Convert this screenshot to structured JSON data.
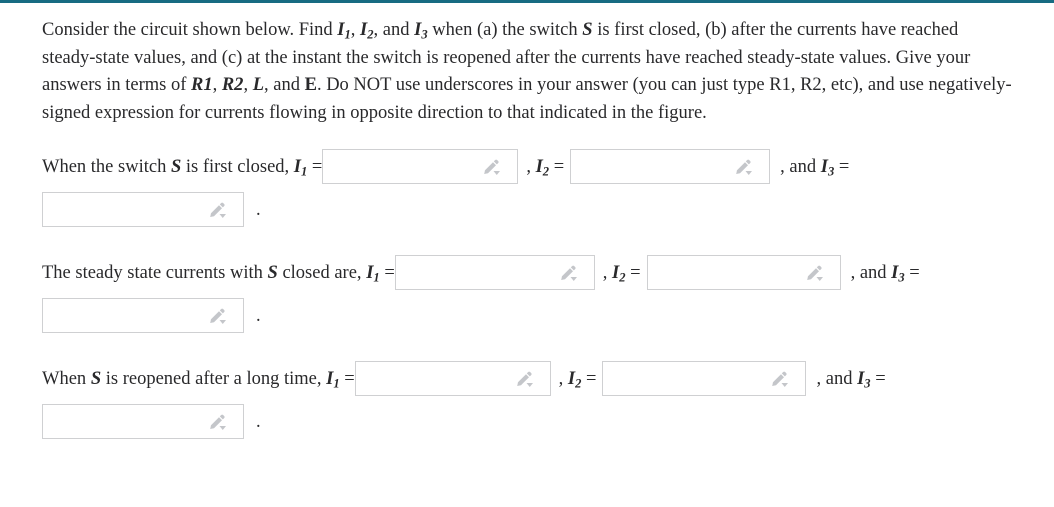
{
  "page": {
    "accent_color": "#176b82",
    "text_color": "#29292b",
    "input_border_color": "#cfd0d2",
    "background": "#ffffff"
  },
  "prompt": {
    "segment_1": "Consider the circuit shown below. Find ",
    "var_i1": "I",
    "sub_1": "1",
    "segment_2": ", ",
    "var_i2": "I",
    "sub_2": "2",
    "segment_3": ", and ",
    "var_i3": "I",
    "sub_3": "3",
    "segment_4": " when (a) the switch ",
    "var_s": "S",
    "segment_5": " is first closed, (b) after the currents have reached steady-state values, and (c) at the instant the switch is reopened after the currents have reached steady-state values. Give your answers in terms of ",
    "var_r1": "R1",
    "segment_6": ", ",
    "var_r2": "R2",
    "segment_7": ", ",
    "var_l": "L",
    "segment_8": ", and ",
    "var_e": "E",
    "segment_9": ". Do NOT use underscores in your answer (you can just type R1, R2, etc), and use negatively-signed expression for currents flowing in opposite direction to that indicated in the figure."
  },
  "questions": [
    {
      "lead_text": "When the switch ",
      "lead_var": "S",
      "lead_tail": " is first closed, ",
      "var_i1": "I",
      "sub_i1": "1",
      "equals_1": " =",
      "sep_i2": ", ",
      "var_i2": "I",
      "sub_i2": "2",
      "equals_2": " =",
      "sep_i3": ", and ",
      "var_i3": "I",
      "sub_i3": "3",
      "equals_3": " =",
      "period": ".",
      "fields": [
        {
          "name": "i1-answer-input",
          "value": "",
          "placeholder": ""
        },
        {
          "name": "i2-answer-input",
          "value": "",
          "placeholder": ""
        },
        {
          "name": "i3-answer-input",
          "value": "",
          "placeholder": ""
        }
      ],
      "icon": "pencil-dropdown-icon"
    },
    {
      "lead_text": "The steady state currents with ",
      "lead_var": "S",
      "lead_tail": " closed are, ",
      "var_i1": "I",
      "sub_i1": "1",
      "equals_1": " =",
      "sep_i2": ", ",
      "var_i2": "I",
      "sub_i2": "2",
      "equals_2": " =",
      "sep_i3": ", and ",
      "var_i3": "I",
      "sub_i3": "3",
      "equals_3": " =",
      "period": ".",
      "fields": [
        {
          "name": "i1-answer-input",
          "value": "",
          "placeholder": ""
        },
        {
          "name": "i2-answer-input",
          "value": "",
          "placeholder": ""
        },
        {
          "name": "i3-answer-input",
          "value": "",
          "placeholder": ""
        }
      ],
      "icon": "pencil-dropdown-icon"
    },
    {
      "lead_text": "When ",
      "lead_var": "S",
      "lead_tail": " is reopened after a long time, ",
      "var_i1": "I",
      "sub_i1": "1",
      "equals_1": " =",
      "sep_i2": ", ",
      "var_i2": "I",
      "sub_i2": "2",
      "equals_2": " =",
      "sep_i3": ", and ",
      "var_i3": "I",
      "sub_i3": "3",
      "equals_3": " =",
      "period": ".",
      "fields": [
        {
          "name": "i1-answer-input",
          "value": "",
          "placeholder": ""
        },
        {
          "name": "i2-answer-input",
          "value": "",
          "placeholder": ""
        },
        {
          "name": "i3-answer-input",
          "value": "",
          "placeholder": ""
        }
      ],
      "icon": "pencil-dropdown-icon"
    }
  ]
}
